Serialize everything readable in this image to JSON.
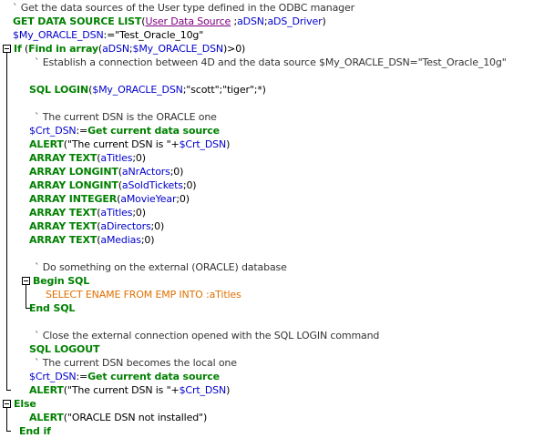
{
  "lines": [
    {
      "indent": 2,
      "tokens": [
        {
          "c": "cm",
          "t": "` Get the data sources of the User type defined in the ODBC manager"
        }
      ]
    },
    {
      "indent": 2,
      "tokens": [
        {
          "c": "kw",
          "t": "GET DATA SOURCE LIST"
        },
        {
          "c": "plain",
          "t": "("
        },
        {
          "c": "tbl",
          "t": "User Data Source"
        },
        {
          "c": "plain",
          "t": " ;"
        },
        {
          "c": "var",
          "t": "aDSN"
        },
        {
          "c": "plain",
          "t": ";"
        },
        {
          "c": "var",
          "t": "aDS_Driver"
        },
        {
          "c": "plain",
          "t": ")"
        }
      ]
    },
    {
      "indent": 2,
      "tokens": [
        {
          "c": "var",
          "t": "$My_ORACLE_DSN"
        },
        {
          "c": "plain",
          "t": ":=\"Test_Oracle_10g\""
        }
      ]
    },
    {
      "indent": 1,
      "fold": "open",
      "tokens": [
        {
          "c": "kw",
          "t": "If"
        },
        {
          "c": "plain",
          "t": " ("
        },
        {
          "c": "kw",
          "t": "Find in array"
        },
        {
          "c": "plain",
          "t": "("
        },
        {
          "c": "var",
          "t": "aDSN"
        },
        {
          "c": "plain",
          "t": ";"
        },
        {
          "c": "var",
          "t": "$My_ORACLE_DSN"
        },
        {
          "c": "plain",
          "t": ")>0)"
        }
      ]
    },
    {
      "indent": 6,
      "tokens": [
        {
          "c": "cm",
          "t": "` Establish a connection between 4D and the data source $My_ORACLE_DSN=\"Test_Oracle_10g\""
        }
      ]
    },
    {
      "indent": 0,
      "tokens": []
    },
    {
      "indent": 5,
      "tokens": [
        {
          "c": "kw",
          "t": "SQL LOGIN"
        },
        {
          "c": "plain",
          "t": "("
        },
        {
          "c": "var",
          "t": "$My_ORACLE_DSN"
        },
        {
          "c": "plain",
          "t": ";\"scott\";\"tiger\";*)"
        }
      ]
    },
    {
      "indent": 0,
      "tokens": []
    },
    {
      "indent": 6,
      "tokens": [
        {
          "c": "cm",
          "t": "` The current DSN is the ORACLE one"
        }
      ]
    },
    {
      "indent": 5,
      "tokens": [
        {
          "c": "var",
          "t": "$Crt_DSN"
        },
        {
          "c": "plain",
          "t": ":="
        },
        {
          "c": "kw",
          "t": "Get current data source"
        }
      ]
    },
    {
      "indent": 5,
      "tokens": [
        {
          "c": "kw",
          "t": "ALERT"
        },
        {
          "c": "plain",
          "t": "(\"The current DSN is \"+"
        },
        {
          "c": "var",
          "t": "$Crt_DSN"
        },
        {
          "c": "plain",
          "t": ")"
        }
      ]
    },
    {
      "indent": 5,
      "tokens": [
        {
          "c": "kw",
          "t": "ARRAY TEXT"
        },
        {
          "c": "plain",
          "t": "("
        },
        {
          "c": "var",
          "t": "aTitles"
        },
        {
          "c": "plain",
          "t": ";0)"
        }
      ]
    },
    {
      "indent": 5,
      "tokens": [
        {
          "c": "kw",
          "t": "ARRAY LONGINT"
        },
        {
          "c": "plain",
          "t": "("
        },
        {
          "c": "var",
          "t": "aNrActors"
        },
        {
          "c": "plain",
          "t": ";0)"
        }
      ]
    },
    {
      "indent": 5,
      "tokens": [
        {
          "c": "kw",
          "t": "ARRAY LONGINT"
        },
        {
          "c": "plain",
          "t": "("
        },
        {
          "c": "var",
          "t": "aSoldTickets"
        },
        {
          "c": "plain",
          "t": ";0)"
        }
      ]
    },
    {
      "indent": 5,
      "tokens": [
        {
          "c": "kw",
          "t": "ARRAY INTEGER"
        },
        {
          "c": "plain",
          "t": "("
        },
        {
          "c": "var",
          "t": "aMovieYear"
        },
        {
          "c": "plain",
          "t": ";0)"
        }
      ]
    },
    {
      "indent": 5,
      "tokens": [
        {
          "c": "kw",
          "t": "ARRAY TEXT"
        },
        {
          "c": "plain",
          "t": "("
        },
        {
          "c": "var",
          "t": "aTitles"
        },
        {
          "c": "plain",
          "t": ";0)"
        }
      ]
    },
    {
      "indent": 5,
      "tokens": [
        {
          "c": "kw",
          "t": "ARRAY TEXT"
        },
        {
          "c": "plain",
          "t": "("
        },
        {
          "c": "var",
          "t": "aDirectors"
        },
        {
          "c": "plain",
          "t": ";0)"
        }
      ]
    },
    {
      "indent": 5,
      "tokens": [
        {
          "c": "kw",
          "t": "ARRAY TEXT"
        },
        {
          "c": "plain",
          "t": "("
        },
        {
          "c": "var",
          "t": "aMedias"
        },
        {
          "c": "plain",
          "t": ";0)"
        }
      ]
    },
    {
      "indent": 0,
      "tokens": []
    },
    {
      "indent": 6,
      "tokens": [
        {
          "c": "cm",
          "t": "` Do something on the external (ORACLE) database"
        }
      ]
    },
    {
      "indent": 5,
      "fold": "open",
      "tokens": [
        {
          "c": "kw",
          "t": "Begin SQL"
        }
      ]
    },
    {
      "indent": 8,
      "tokens": [
        {
          "c": "sql",
          "t": "SELECT ENAME FROM EMP INTO :aTitles"
        }
      ]
    },
    {
      "indent": 5,
      "fold": "end",
      "tokens": [
        {
          "c": "kw",
          "t": "End SQL"
        }
      ]
    },
    {
      "indent": 0,
      "tokens": []
    },
    {
      "indent": 6,
      "tokens": [
        {
          "c": "cm",
          "t": "` Close the external connection opened with the SQL LOGIN command"
        }
      ]
    },
    {
      "indent": 5,
      "tokens": [
        {
          "c": "kw",
          "t": "SQL LOGOUT"
        }
      ]
    },
    {
      "indent": 6,
      "tokens": [
        {
          "c": "cm",
          "t": "` The current DSN becomes the local one"
        }
      ]
    },
    {
      "indent": 5,
      "tokens": [
        {
          "c": "var",
          "t": "$Crt_DSN"
        },
        {
          "c": "plain",
          "t": ":="
        },
        {
          "c": "kw",
          "t": "Get current data source"
        }
      ]
    },
    {
      "indent": 5,
      "tokens": [
        {
          "c": "kw",
          "t": "ALERT"
        },
        {
          "c": "plain",
          "t": "(\"The current DSN is \"+"
        },
        {
          "c": "var",
          "t": "$Crt_DSN"
        },
        {
          "c": "plain",
          "t": ")"
        }
      ]
    },
    {
      "indent": 1,
      "fold": "open",
      "tokens": [
        {
          "c": "kw",
          "t": "Else"
        }
      ]
    },
    {
      "indent": 5,
      "tokens": [
        {
          "c": "kw",
          "t": "ALERT"
        },
        {
          "c": "plain",
          "t": "(\"ORACLE DSN not installed\")"
        }
      ]
    },
    {
      "indent": 1,
      "fold": "end",
      "tokens": [
        {
          "c": "kw",
          "t": "End if"
        }
      ]
    }
  ],
  "colors": {
    "comment": "#333333",
    "keyword": "#008000",
    "variable": "#0000cc",
    "table": "#800080",
    "sql": "#e07000",
    "background": "#ffffff"
  },
  "icons": {
    "fold_open": "fold-minus-icon"
  }
}
